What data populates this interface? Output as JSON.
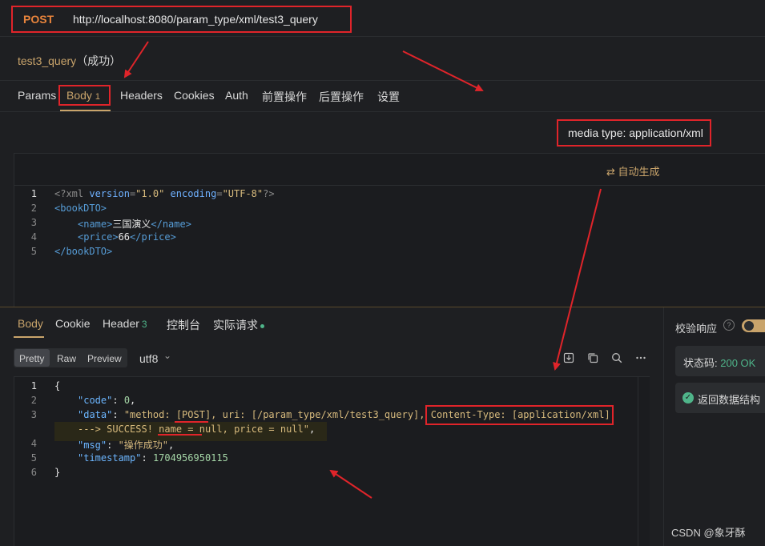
{
  "request": {
    "method": "POST",
    "url": "http://localhost:8080/param_type/xml/test3_query",
    "name": "test3_query",
    "status_text": "（成功）"
  },
  "request_tabs": [
    {
      "label": "Params"
    },
    {
      "label": "Body",
      "count": "1"
    },
    {
      "label": "Headers"
    },
    {
      "label": "Cookies"
    },
    {
      "label": "Auth"
    },
    {
      "label": "前置操作"
    },
    {
      "label": "后置操作"
    },
    {
      "label": "设置"
    }
  ],
  "media_type": "media type: application/xml",
  "autogen_label": "自动生成",
  "request_body": {
    "line_numbers": [
      "1",
      "2",
      "3",
      "4",
      "5"
    ],
    "decl_open": "<?xml ",
    "decl_version_attr": "version",
    "decl_version_val": "\"1.0\"",
    "decl_encoding_attr": "encoding",
    "decl_encoding_val": "\"UTF-8\"",
    "decl_close": "?>",
    "root_open": "<bookDTO>",
    "name_open": "<name>",
    "name_value": "三国演义",
    "name_close": "</name>",
    "price_open": "<price>",
    "price_value": "66",
    "price_close": "</price>",
    "root_close": "</bookDTO>"
  },
  "response_tabs": [
    {
      "label": "Body"
    },
    {
      "label": "Cookie"
    },
    {
      "label": "Header",
      "count": "3"
    },
    {
      "label": "控制台"
    },
    {
      "label": "实际请求"
    }
  ],
  "format_buttons": [
    "Pretty",
    "Raw",
    "Preview"
  ],
  "encoding": "utf8",
  "response_body": {
    "line_numbers": [
      "1",
      "2",
      "3",
      "",
      "4",
      "5",
      "6"
    ],
    "open": "{",
    "code_key": "\"code\"",
    "code_val": "0",
    "data_key": "\"data\"",
    "data_val_a": "\"method: [POST], uri: [/param_type/xml/test3_query], Content-Type: [application/xml]",
    "data_val_b": "---> SUCCESS! name = null, price = null\"",
    "msg_key": "\"msg\"",
    "msg_val": "\"操作成功\"",
    "ts_key": "\"timestamp\"",
    "ts_val": "1704956950115",
    "close": "}"
  },
  "right_panel": {
    "verify_label": "校验响应",
    "status_label": "状态码: ",
    "status_value": "200 OK",
    "struct_label": "返回数据结构"
  },
  "watermark": "CSDN @象牙酥",
  "colors": {
    "accent": "#c9a46b",
    "method": "#e8843c",
    "success": "#4fb58a",
    "annotation": "#e0242a"
  }
}
